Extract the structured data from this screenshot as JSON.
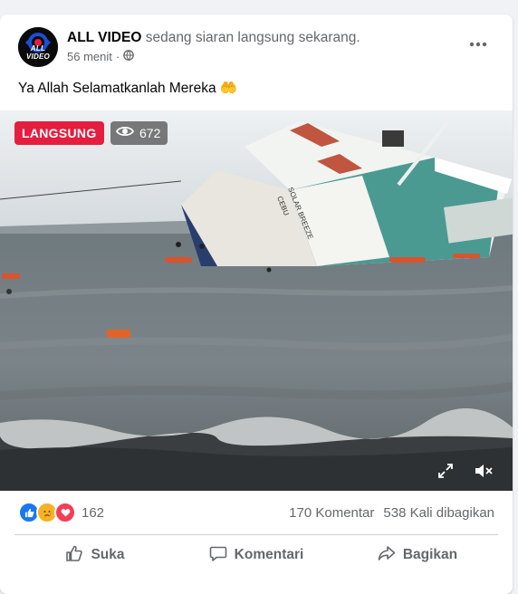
{
  "post": {
    "page_name": "ALL VIDEO",
    "live_status_text": "sedang siaran langsung sekarang.",
    "time": "56 menit",
    "separator": "·",
    "avatar_logo_text": "ALL VIDEO",
    "caption": "Ya Allah Selamatkanlah Mereka 🤲"
  },
  "video": {
    "live_badge": "LANGSUNG",
    "viewer_count": "672",
    "ship_text_1": "SOLAR BREEZE",
    "ship_text_2": "CEBU"
  },
  "stats": {
    "reaction_count": "162",
    "comments": "170 Komentar",
    "shares": "538 Kali dibagikan",
    "reaction_icons": [
      "like-reaction",
      "sad-reaction",
      "love-reaction"
    ]
  },
  "actions": {
    "like": "Suka",
    "comment": "Komentari",
    "share": "Bagikan"
  },
  "colors": {
    "live_red": "#e41e3f",
    "like_blue": "#1877f2",
    "love_red": "#f33e58",
    "sad_yellow": "#f7b125",
    "secondary_text": "#65676b"
  }
}
